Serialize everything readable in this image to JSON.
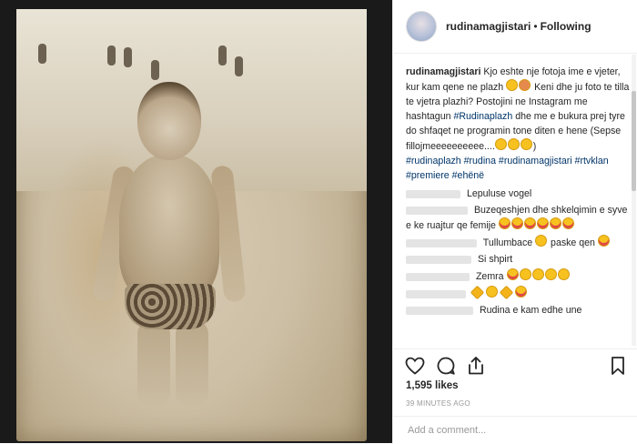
{
  "post": {
    "username": "rudinamagjistari",
    "separator": "•",
    "follow_status": "Following"
  },
  "caption": {
    "author": "rudinamagjistari",
    "text_1": "Kjo eshte nje fotoja ime e vjeter, kur kam qene ne plazh",
    "text_2": "Keni dhe ju foto te tilla te vjetra plazhi? Postojini ne Instagram me hashtagun",
    "hashtag_main": "#Rudinaplazh",
    "text_3": "dhe me e bukura prej tyre do shfaqet ne programin tone diten e hene (Sepse fillojmeeeeeeeeee....",
    "text_4": ")",
    "hashtags": [
      "#rudinaplazh",
      "#rudina",
      "#rudinamagjistari",
      "#rtvklan",
      "#premiere",
      "#ehënë"
    ]
  },
  "comments": [
    {
      "text": "Lepuluse vogel"
    },
    {
      "text": "Buzeqeshjen dhe shkelqimin e syve e ke ruajtur qe femije"
    },
    {
      "text": "Tullumbace",
      "text_b": "paske qen"
    },
    {
      "text": "Si shpirt"
    },
    {
      "text": "Zemra"
    },
    {
      "text": ""
    },
    {
      "text": "Rudina e kam edhe une"
    }
  ],
  "likes": "1,595 likes",
  "timestamp": "39 MINUTES AGO",
  "add_comment": {
    "placeholder": "Add a comment..."
  },
  "icons": [
    "heart-icon",
    "comment-icon",
    "share-icon",
    "bookmark-icon"
  ]
}
